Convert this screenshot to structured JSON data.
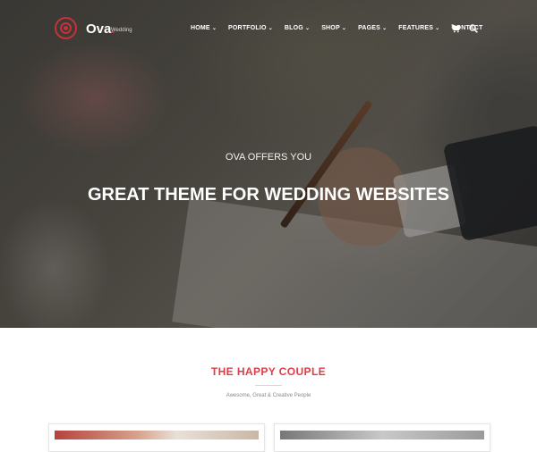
{
  "brand": {
    "name": "Ova",
    "dot": ".",
    "tagline": "Wedding",
    "accent": "#e23b47"
  },
  "nav": {
    "items": [
      {
        "label": "HOME",
        "dropdown": true
      },
      {
        "label": "PORTFOLIO",
        "dropdown": true
      },
      {
        "label": "BLOG",
        "dropdown": true
      },
      {
        "label": "SHOP",
        "dropdown": true
      },
      {
        "label": "PAGES",
        "dropdown": true
      },
      {
        "label": "FEATURES",
        "dropdown": true
      },
      {
        "label": "CONTACT",
        "dropdown": false
      }
    ],
    "icons": [
      "cart-icon",
      "search-icon"
    ]
  },
  "hero": {
    "subtitle": "OVA OFFERS YOU",
    "title": "GREAT THEME FOR WEDDING WEBSITES"
  },
  "section": {
    "title": "THE HAPPY COUPLE",
    "subtitle": "Awesome, Great & Creative People"
  }
}
